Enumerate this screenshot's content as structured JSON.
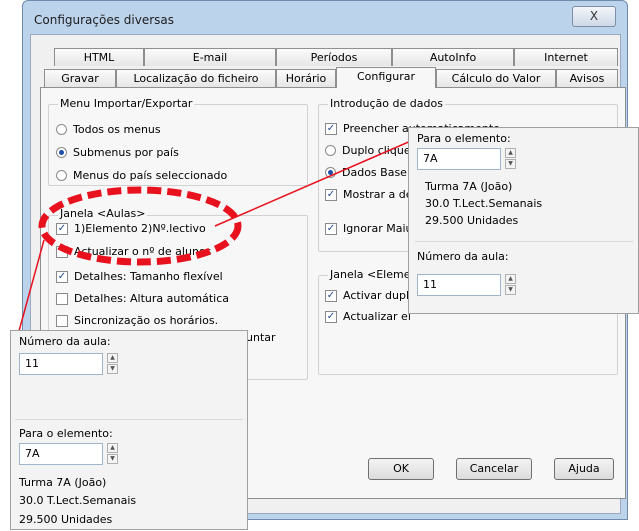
{
  "window": {
    "title": "Configurações diversas",
    "close_glyph": "X"
  },
  "tabs_row1": [
    "HTML",
    "E-mail",
    "Períodos",
    "AutoInfo",
    "Internet"
  ],
  "tabs_row2": [
    "Gravar",
    "Localização do ficheiro",
    "Horário",
    "Configurar",
    "Cálculo do Valor",
    "Avisos"
  ],
  "selected_tab": "Configurar",
  "menu_group": {
    "title": "Menu Importar/Exportar",
    "options": [
      {
        "label": "Todos os menus",
        "checked": false
      },
      {
        "label": "Submenus por país",
        "checked": true
      },
      {
        "label": "Menus do país seleccionado",
        "checked": false
      }
    ]
  },
  "aulas_group": {
    "title": "Janela <Aulas>",
    "items": [
      {
        "label": "1)Elemento 2)Nº.lectivo",
        "checked": true
      },
      {
        "label": "Actualizar o nº de alunos",
        "checked": false
      },
      {
        "label": "Detalhes: Tamanho flexível",
        "checked": true
      },
      {
        "label": "Detalhes: Altura automática",
        "checked": false
      },
      {
        "label": "Sincronização os horários.",
        "checked": false
      }
    ],
    "juntar_fragment": "untar"
  },
  "intro_group": {
    "title": "Introdução de dados",
    "items": [
      {
        "label": "Preencher automaticamente",
        "kind": "check",
        "checked": true
      },
      {
        "label": "Duplo clique",
        "kind": "radio",
        "checked": false
      },
      {
        "label": "Dados Base",
        "kind": "radio",
        "checked": true
      },
      {
        "label": "Mostrar a de",
        "kind": "check",
        "checked": true
      },
      {
        "label": "Ignorar Maiú",
        "kind": "check",
        "checked": true
      }
    ]
  },
  "elem_group": {
    "title": "Janela <Eleme",
    "items": [
      {
        "label": "Activar dupl",
        "checked": true
      },
      {
        "label": "Actualizar el",
        "checked": true
      }
    ]
  },
  "buttons": {
    "ok": "OK",
    "cancel": "Cancelar",
    "help": "Ajuda"
  },
  "popup_right": {
    "elem_label": "Para o elemento:",
    "elem_value": "7A",
    "info": [
      "Turma 7A (João)",
      "30.0 T.Lect.Semanais",
      "29.500 Unidades"
    ],
    "aula_label": "Número da aula:",
    "aula_value": "11"
  },
  "popup_left": {
    "aula_label": "Número da aula:",
    "aula_value": "11",
    "elem_label": "Para o elemento:",
    "elem_value": "7A",
    "info": [
      "Turma 7A (João)",
      "30.0 T.Lect.Semanais",
      "29.500 Unidades"
    ]
  },
  "colors": {
    "accent": "#1d4fa8",
    "annotation": "#e8121f",
    "titlebar": "#bcd3ec"
  }
}
